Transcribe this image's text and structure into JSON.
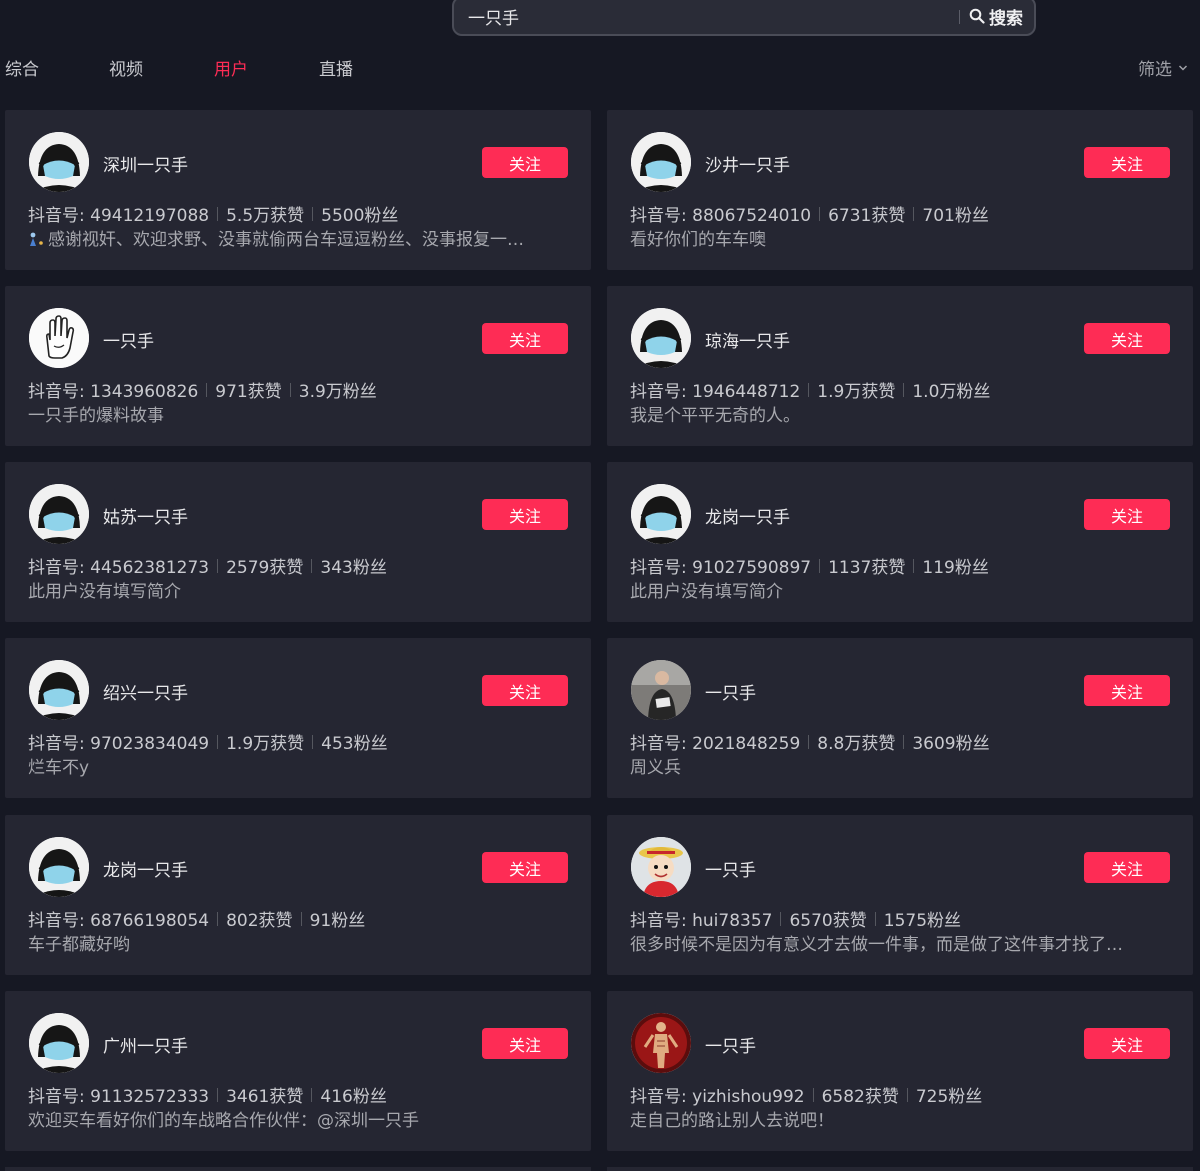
{
  "search": {
    "query": "一只手",
    "button_label": "搜索"
  },
  "tabs": [
    {
      "label": "综合",
      "active": false
    },
    {
      "label": "视频",
      "active": false
    },
    {
      "label": "用户",
      "active": true
    },
    {
      "label": "直播",
      "active": false
    }
  ],
  "filter_label": "筛选",
  "colors": {
    "accent": "#fe2c55",
    "background": "#161823",
    "card": "#252632"
  },
  "users": [
    {
      "name": "深圳一只手",
      "id_label": "抖音号: 49412197088",
      "likes": "5.5万获赞",
      "fans": "5500粉丝",
      "bio": "感谢视奸、欢迎求野、没事就偷两台车逗逗粉丝、没事报复一…",
      "avatar": "mask-avatar",
      "follow": "关注"
    },
    {
      "name": "沙井一只手",
      "id_label": "抖音号: 88067524010",
      "likes": "6731获赞",
      "fans": "701粉丝",
      "bio": "看好你们的车车噢",
      "avatar": "mask-avatar",
      "follow": "关注"
    },
    {
      "name": "一只手",
      "id_label": "抖音号: 1343960826",
      "likes": "971获赞",
      "fans": "3.9万粉丝",
      "bio": "一只手的爆料故事",
      "avatar": "hand-avatar",
      "follow": "关注"
    },
    {
      "name": "琼海一只手",
      "id_label": "抖音号: 1946448712",
      "likes": "1.9万获赞",
      "fans": "1.0万粉丝",
      "bio": "我是个平平无奇的人。",
      "avatar": "mask-avatar",
      "follow": "关注"
    },
    {
      "name": "姑苏一只手",
      "id_label": "抖音号: 44562381273",
      "likes": "2579获赞",
      "fans": "343粉丝",
      "bio": "此用户没有填写简介",
      "avatar": "mask-avatar",
      "follow": "关注"
    },
    {
      "name": "龙岗一只手",
      "id_label": "抖音号: 91027590897",
      "likes": "1137获赞",
      "fans": "119粉丝",
      "bio": "此用户没有填写简介",
      "avatar": "mask-avatar",
      "follow": "关注"
    },
    {
      "name": "绍兴一只手",
      "id_label": "抖音号: 97023834049",
      "likes": "1.9万获赞",
      "fans": "453粉丝",
      "bio": "烂车不y",
      "avatar": "mask-avatar",
      "follow": "关注"
    },
    {
      "name": "一只手",
      "id_label": "抖音号: 2021848259",
      "likes": "8.8万获赞",
      "fans": "3609粉丝",
      "bio": "周义兵",
      "avatar": "photo-person-avatar",
      "follow": "关注"
    },
    {
      "name": "龙岗一只手",
      "id_label": "抖音号: 68766198054",
      "likes": "802获赞",
      "fans": "91粉丝",
      "bio": "车子都藏好哟",
      "avatar": "mask-avatar",
      "follow": "关注"
    },
    {
      "name": "一只手",
      "id_label": "抖音号: hui78357",
      "likes": "6570获赞",
      "fans": "1575粉丝",
      "bio": "很多时候不是因为有意义才去做一件事，而是做了这件事才找了…",
      "avatar": "cartoon-avatar",
      "follow": "关注"
    },
    {
      "name": "广州一只手",
      "id_label": "抖音号: 91132572333",
      "likes": "3461获赞",
      "fans": "416粉丝",
      "bio": "欢迎买车看好你们的车战略合作伙伴：@深圳一只手",
      "avatar": "mask-avatar",
      "follow": "关注"
    },
    {
      "name": "一只手",
      "id_label": "抖音号: yizhishou992",
      "likes": "6582获赞",
      "fans": "725粉丝",
      "bio": "走自己的路让别人去说吧！",
      "avatar": "figure-avatar",
      "follow": "关注"
    }
  ]
}
